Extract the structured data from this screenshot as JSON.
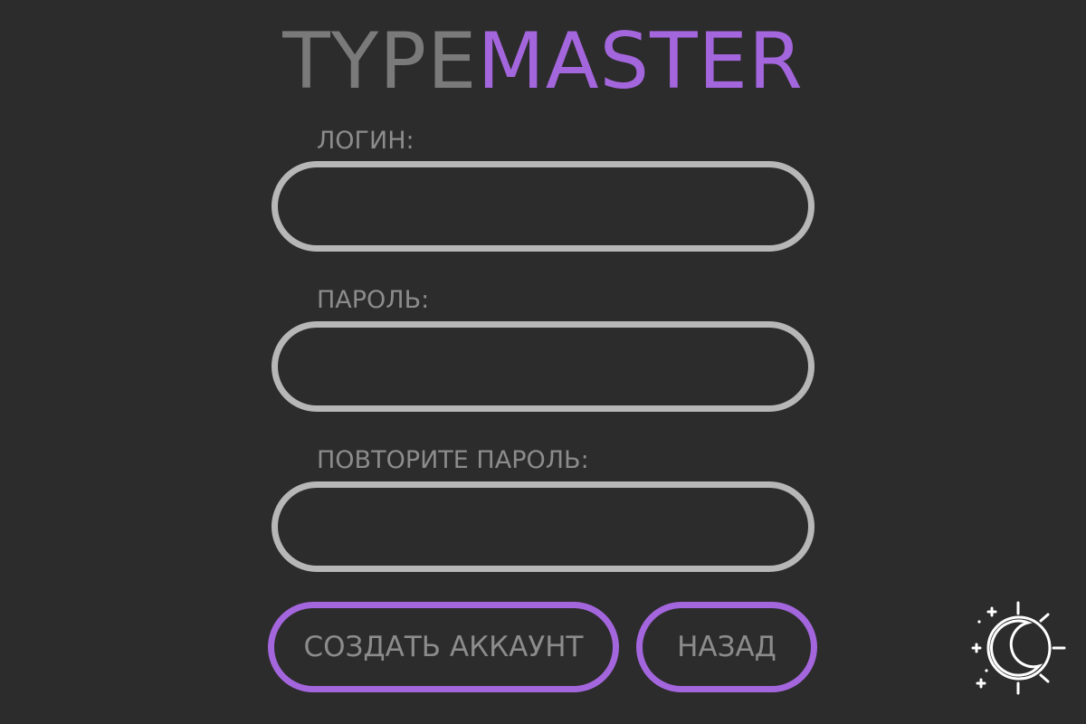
{
  "app": {
    "logo_part1": "TYPE",
    "logo_part2": "MASTER"
  },
  "form": {
    "login_label": "ЛОГИН:",
    "login_value": "",
    "password_label": "ПАРОЛЬ:",
    "password_value": "",
    "repeat_password_label": "ПОВТОРИТЕ ПАРОЛЬ:",
    "repeat_password_value": ""
  },
  "actions": {
    "create_account_label": "СОЗДАТЬ АККАУНТ",
    "back_label": "НАЗАД"
  },
  "theme_toggle": {
    "icon": "moon-sun-icon"
  },
  "colors": {
    "background": "#2c2c2c",
    "accent": "#a466dd",
    "logo_gray": "#7a7a7a",
    "label_gray": "#8c8c8c",
    "input_border": "#b7b7b7"
  }
}
